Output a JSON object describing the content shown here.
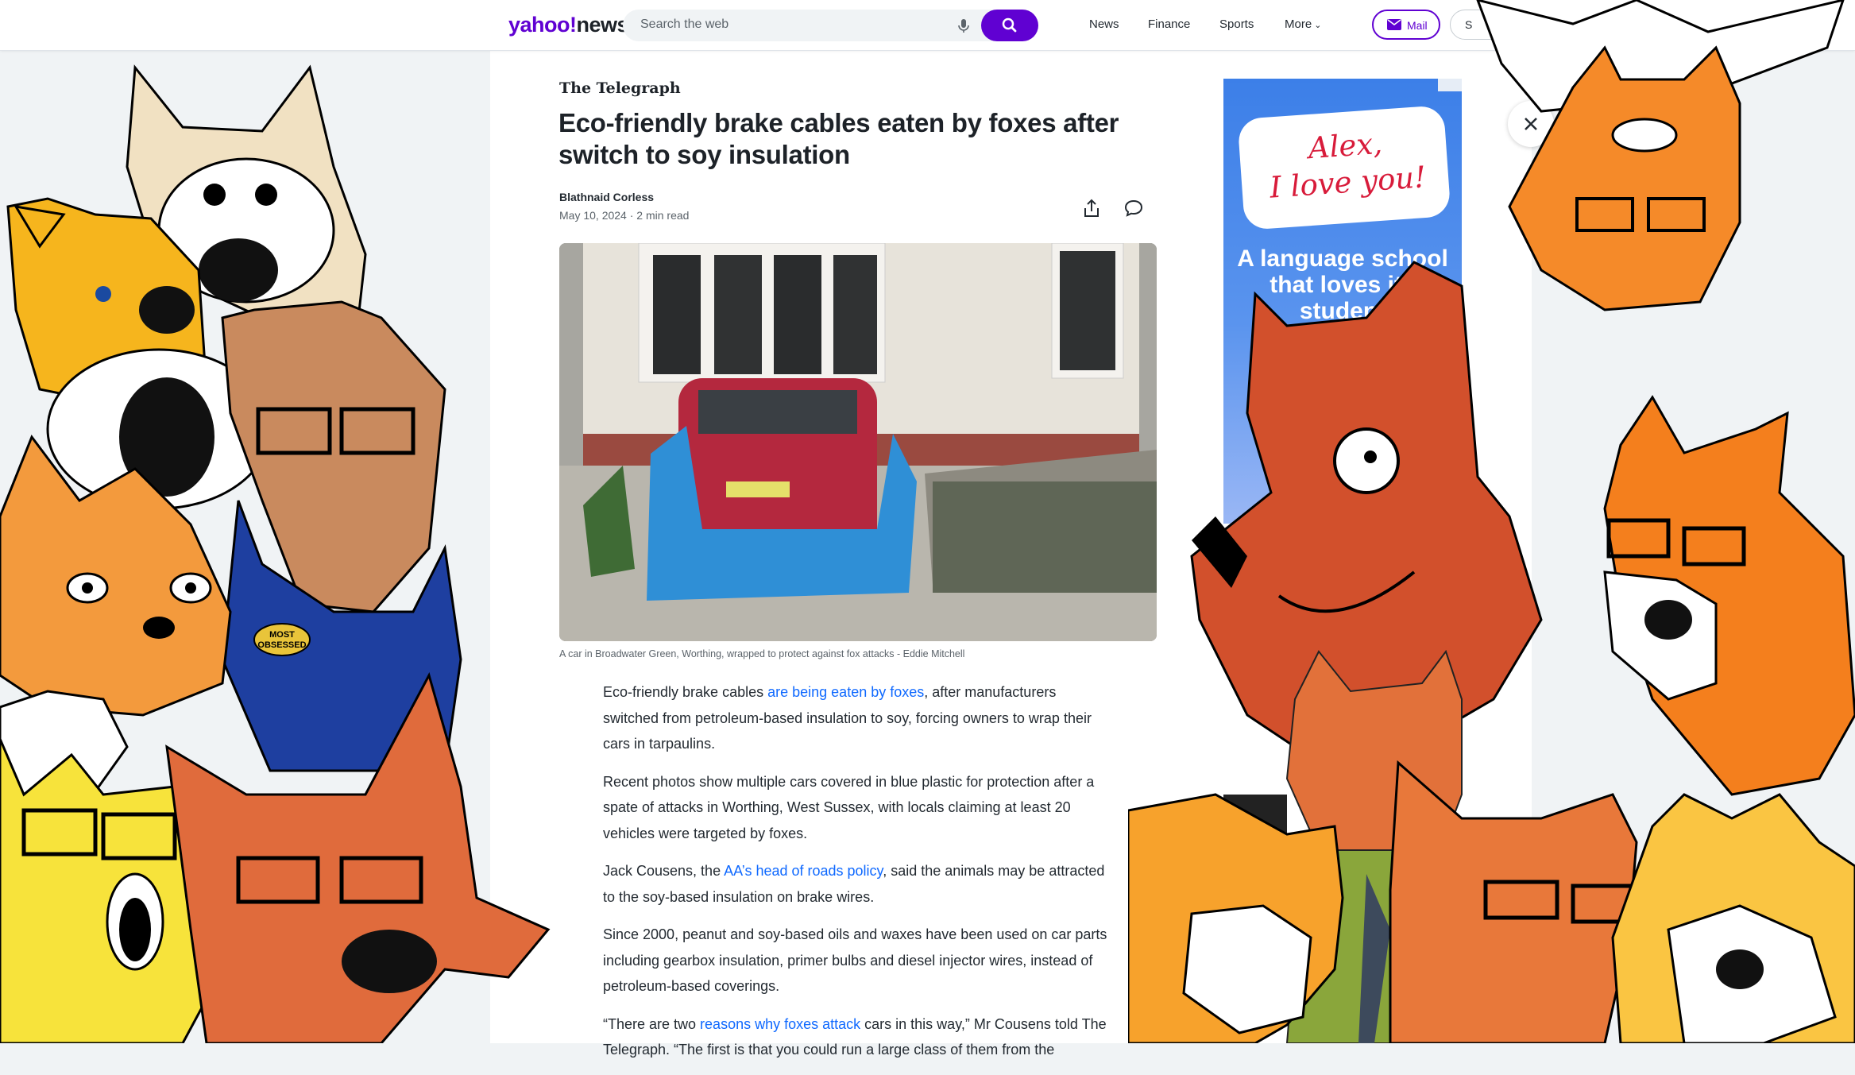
{
  "header": {
    "logo_primary": "yahoo!",
    "logo_secondary": "news",
    "search_placeholder": "Search the web",
    "nav": [
      "News",
      "Finance",
      "Sports",
      "More"
    ],
    "mail_label": "Mail",
    "signin_label": "S"
  },
  "article": {
    "publisher": "The Telegraph",
    "title": "Eco-friendly brake cables eaten by foxes after switch to soy insulation",
    "author": "Blathnaid Corless",
    "date": "May 10, 2024",
    "read_time": "2 min read",
    "caption": "A car in Broadwater Green, Worthing, wrapped to protect against fox attacks - Eddie Mitchell",
    "paragraphs": [
      {
        "before": "Eco-friendly brake cables ",
        "link": "are being eaten by foxes",
        "after": ", after manufacturers switched from petroleum-based insulation to soy, forcing owners to wrap their cars in tarpaulins."
      },
      {
        "before": "Recent photos show multiple cars covered in blue plastic for protection after a spate of attacks in Worthing, West Sussex, with locals claiming at least 20 vehicles were targeted by foxes.",
        "link": "",
        "after": ""
      },
      {
        "before": "Jack Cousens, the ",
        "link": "AA’s head of roads policy",
        "after": ", said the animals may be attracted to the soy-based insulation on brake wires."
      },
      {
        "before": "Since 2000, peanut and soy-based oils and waxes have been used on car parts including gearbox insulation, primer bulbs and diesel injector wires, instead of petroleum-based coverings.",
        "link": "",
        "after": ""
      },
      {
        "before": "“There are two ",
        "link": "reasons why foxes attack",
        "after": " cars in this way,” Mr Cousens told The Telegraph. “The first is that you could run a large class of them from the"
      }
    ]
  },
  "ad": {
    "headline": "Alex,\nI love you!",
    "copy": "A language school that loves its student",
    "badge_color": "#3c7fe8"
  },
  "overlay": {
    "badge_text": "MOST OBSESSED"
  },
  "icons": [
    "search-icon",
    "mic-icon",
    "mail-icon",
    "share-icon",
    "comment-icon",
    "close-icon",
    "chevron-down-icon"
  ],
  "colors": {
    "brand": "#6001d2",
    "link": "#0f69ff",
    "fox_orange": "#f28a3a"
  }
}
